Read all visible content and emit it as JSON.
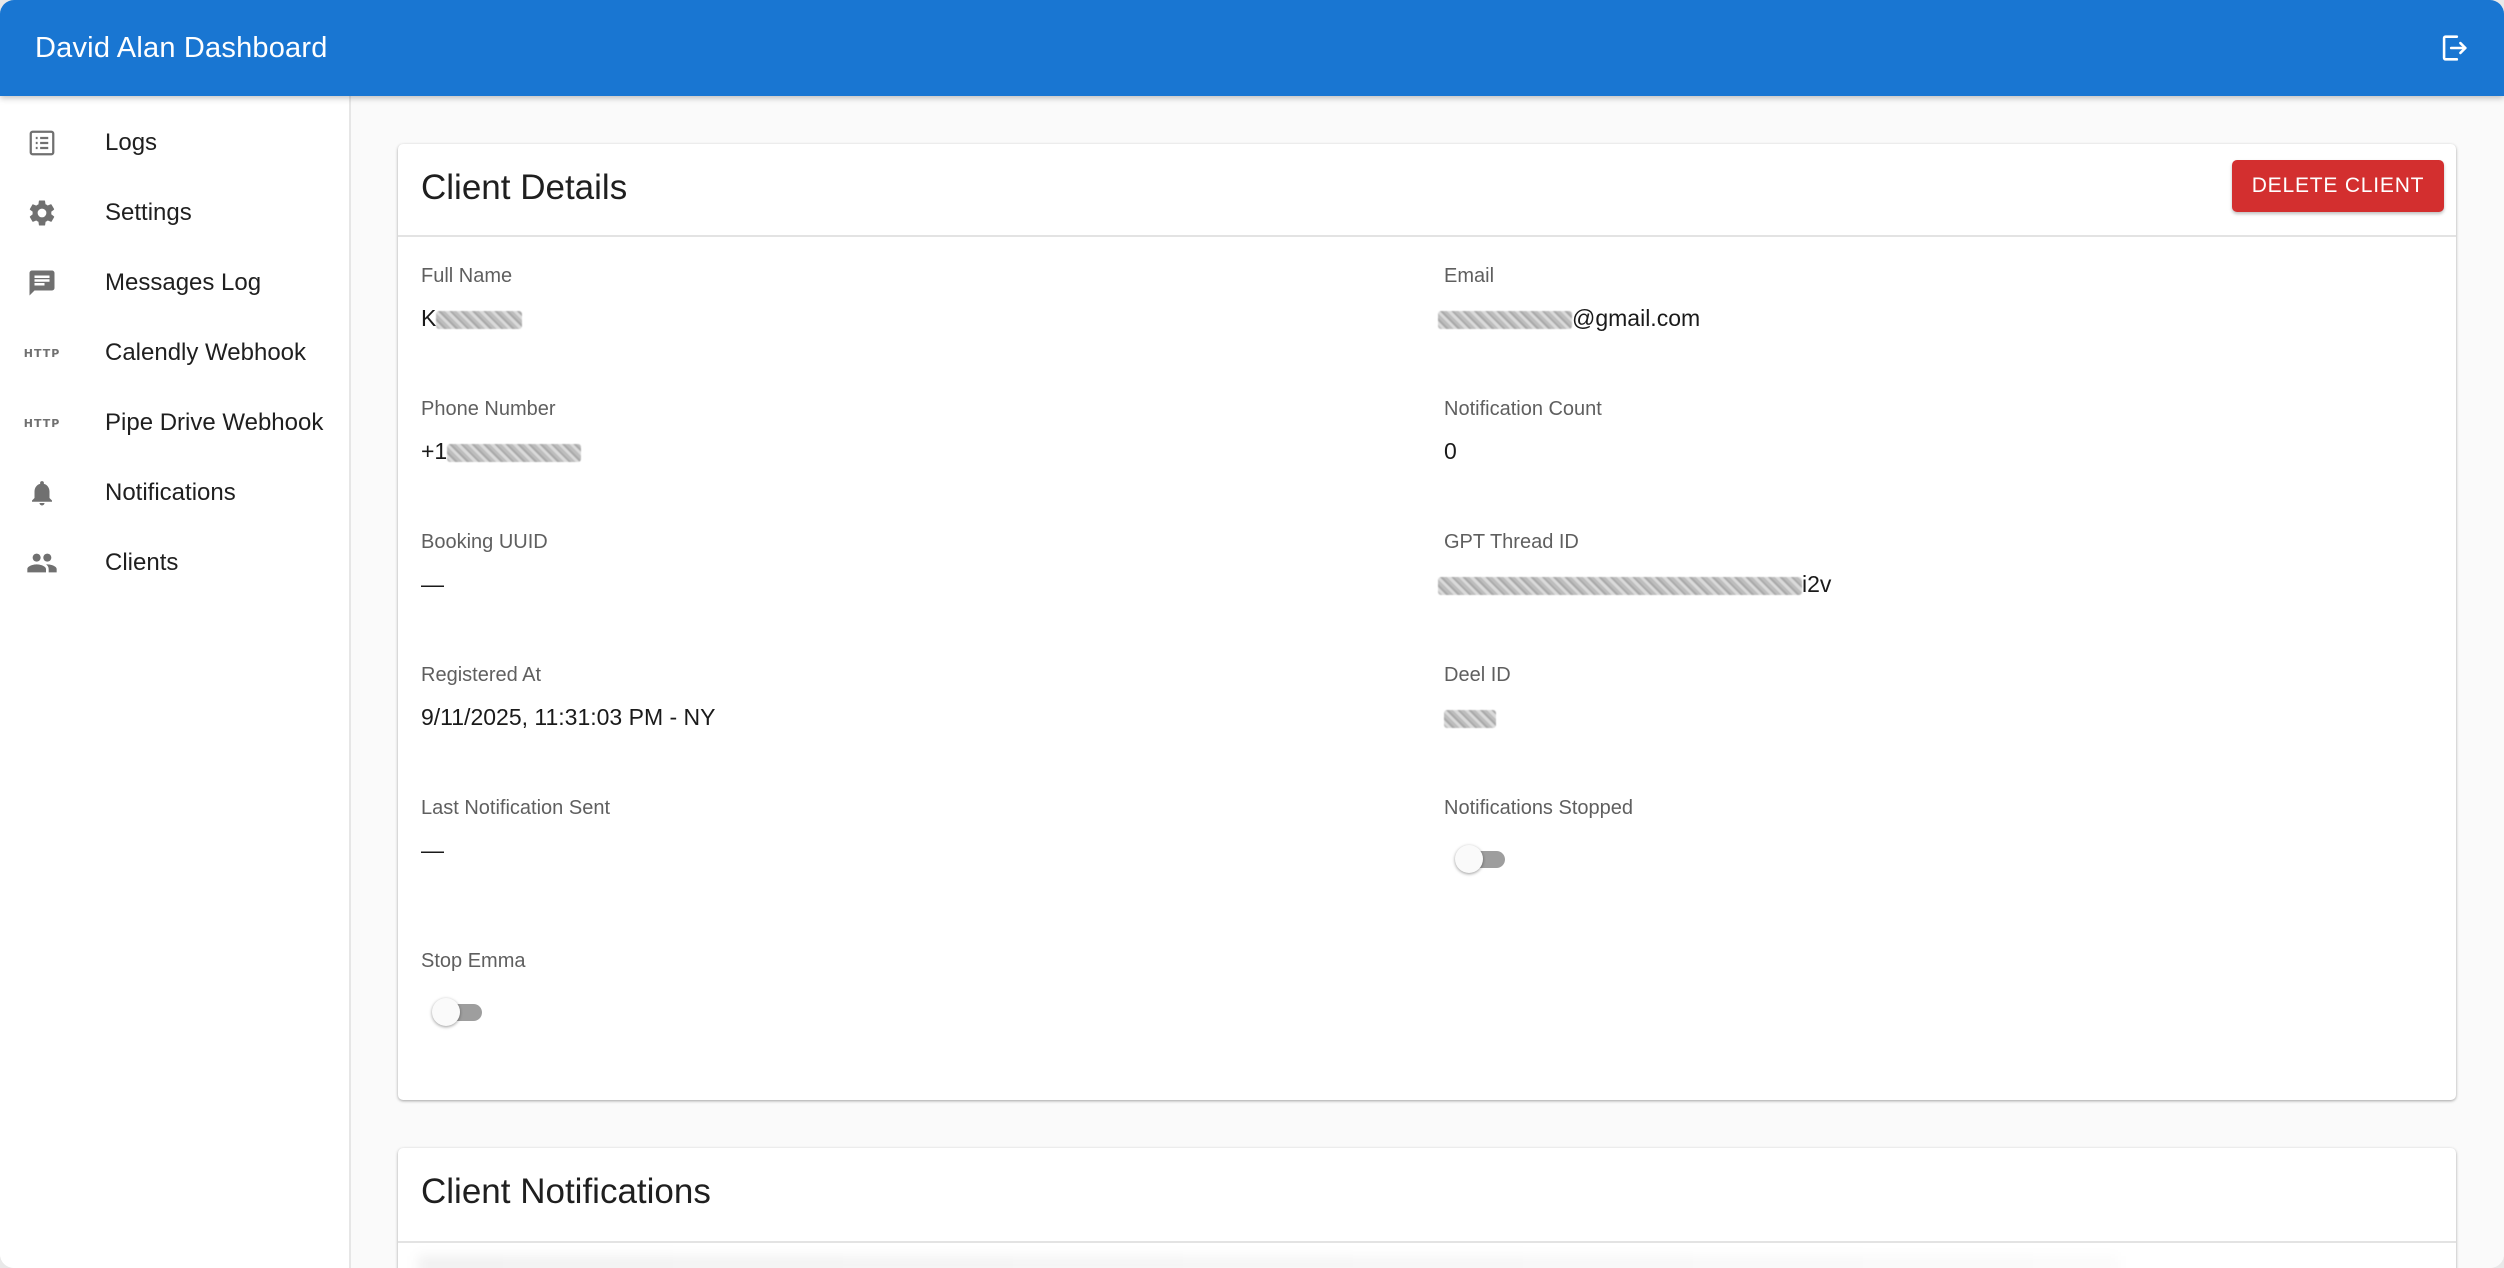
{
  "appbar": {
    "title": "David Alan Dashboard",
    "logout_icon": "logout-icon"
  },
  "sidebar": {
    "items": [
      {
        "label": "Logs",
        "icon": "list-icon"
      },
      {
        "label": "Settings",
        "icon": "gear-icon"
      },
      {
        "label": "Messages Log",
        "icon": "message-icon"
      },
      {
        "label": "Calendly Webhook",
        "icon": "http-icon",
        "icon_text": "HTTP"
      },
      {
        "label": "Pipe Drive Webhook",
        "icon": "http-icon",
        "icon_text": "HTTP"
      },
      {
        "label": "Notifications",
        "icon": "bell-icon"
      },
      {
        "label": "Clients",
        "icon": "people-icon"
      }
    ]
  },
  "client_details": {
    "title": "Client Details",
    "delete_label": "DELETE CLIENT",
    "full_name_label": "Full Name",
    "full_name_prefix": "K",
    "email_label": "Email",
    "email_suffix": "@gmail.com",
    "phone_label": "Phone Number",
    "phone_prefix": "+1",
    "notification_count_label": "Notification Count",
    "notification_count": "0",
    "booking_uuid_label": "Booking UUID",
    "booking_uuid": "—",
    "gpt_thread_label": "GPT Thread ID",
    "gpt_thread_suffix": "i2v",
    "registered_label": "Registered At",
    "registered_at": "9/11/2025, 11:31:03 PM - NY",
    "deel_id_label": "Deel ID",
    "last_notification_label": "Last Notification Sent",
    "last_notification": "—",
    "notifications_stopped_label": "Notifications Stopped",
    "notifications_stopped": false,
    "stop_emma_label": "Stop Emma",
    "stop_emma": false
  },
  "client_notifications": {
    "title": "Client Notifications"
  },
  "colors": {
    "appbar": "#1976d2",
    "delete": "#d32f2f",
    "toggle_off_track": "#9e9e9e"
  }
}
